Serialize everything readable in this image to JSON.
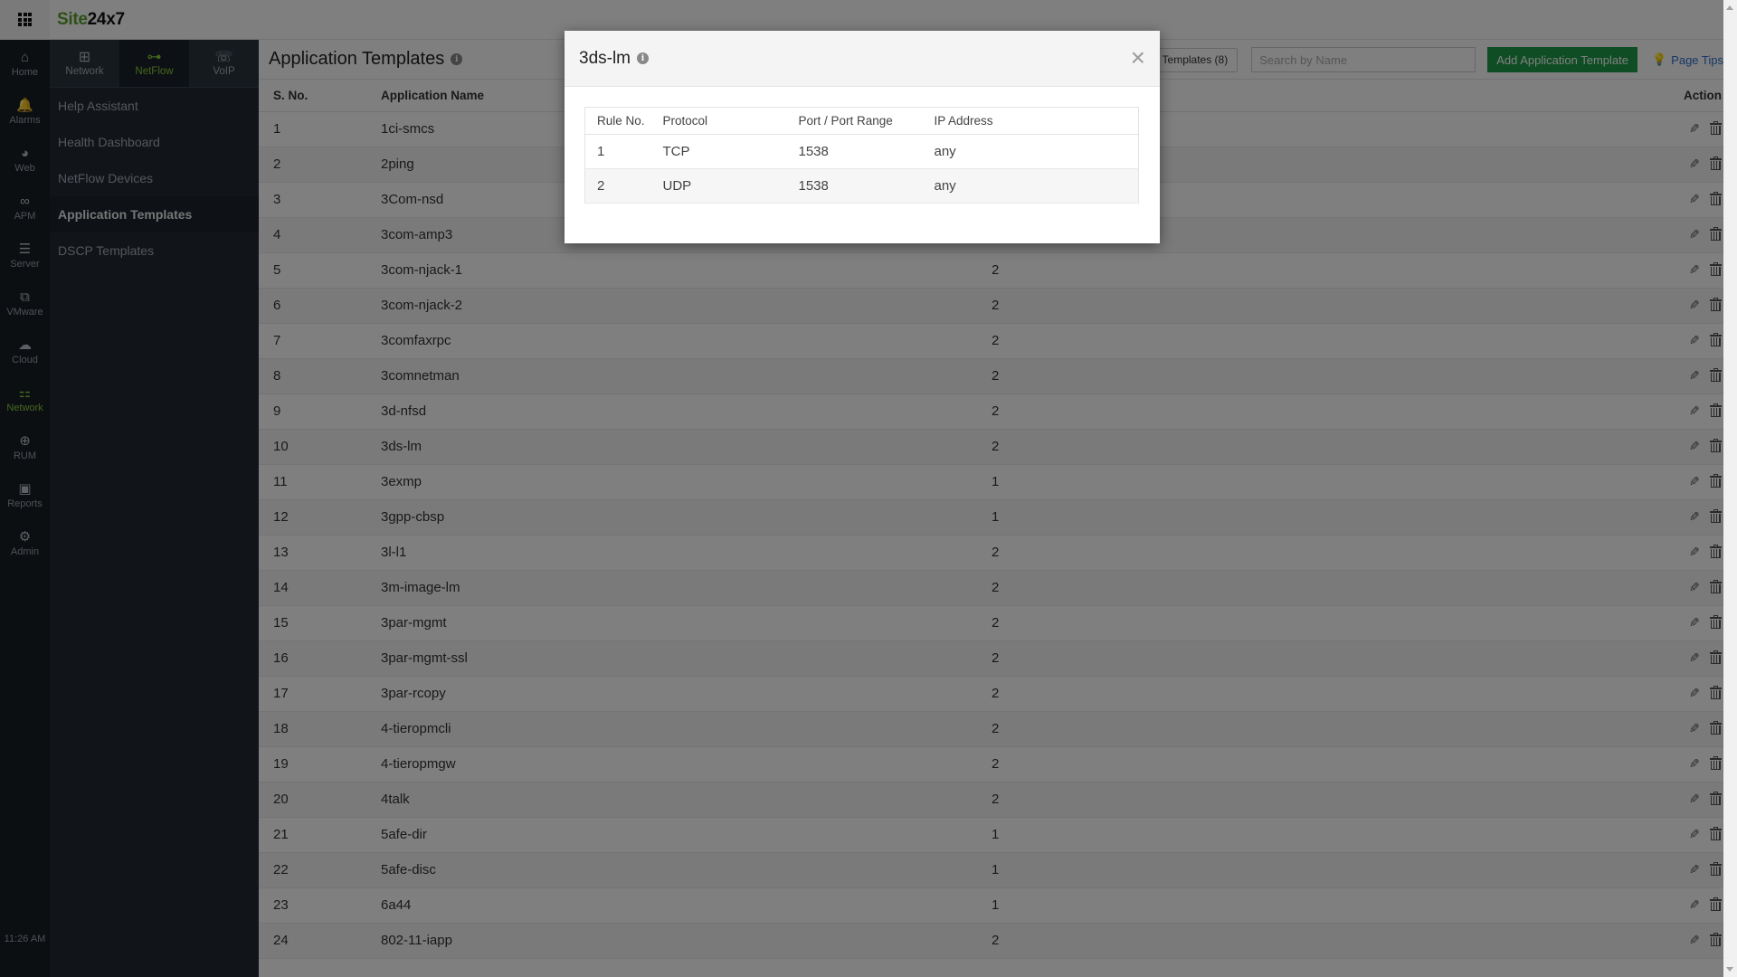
{
  "app": {
    "logo_part1": "Site",
    "logo_part2": "24x7",
    "apps_icon": "grid-icon"
  },
  "rail": {
    "items": [
      {
        "label": "Home",
        "icon": "home-icon",
        "glyph": "⌂"
      },
      {
        "label": "Alarms",
        "icon": "bell-icon",
        "glyph": "🔔"
      },
      {
        "label": "Web",
        "icon": "globe-icon",
        "glyph": "◕"
      },
      {
        "label": "APM",
        "icon": "binoculars-icon",
        "glyph": "∞"
      },
      {
        "label": "Server",
        "icon": "server-icon",
        "glyph": "☰"
      },
      {
        "label": "VMware",
        "icon": "vmware-icon",
        "glyph": "⧉"
      },
      {
        "label": "Cloud",
        "icon": "cloud-icon",
        "glyph": "☁"
      },
      {
        "label": "Network",
        "icon": "network-icon",
        "glyph": "⚏",
        "active": true
      },
      {
        "label": "RUM",
        "icon": "rum-icon",
        "glyph": "⊕"
      },
      {
        "label": "Reports",
        "icon": "reports-icon",
        "glyph": "▣"
      },
      {
        "label": "Admin",
        "icon": "gear-icon",
        "glyph": "⚙"
      }
    ],
    "time": "11:26 AM"
  },
  "sidebar": {
    "tabs": [
      {
        "label": "Network",
        "icon": "network-devices-icon",
        "glyph": "⊞"
      },
      {
        "label": "NetFlow",
        "icon": "netflow-icon",
        "glyph": "⊶",
        "active": true
      },
      {
        "label": "VoIP",
        "icon": "voip-icon",
        "glyph": "☏"
      }
    ],
    "items": [
      {
        "label": "Help Assistant"
      },
      {
        "label": "Health Dashboard"
      },
      {
        "label": "NetFlow Devices"
      },
      {
        "label": "Application Templates",
        "active": true
      },
      {
        "label": "DSCP Templates"
      }
    ]
  },
  "main": {
    "title": "Application Templates",
    "custom_templates_button": "Templates (8)",
    "search_placeholder": "Search by Name",
    "add_button": "Add Application Template",
    "page_tips": "Page Tips",
    "columns": {
      "sno": "S. No.",
      "name": "Application Name",
      "action": "Action"
    },
    "rows": [
      {
        "sno": "1",
        "name": "1ci-smcs",
        "count": ""
      },
      {
        "sno": "2",
        "name": "2ping",
        "count": ""
      },
      {
        "sno": "3",
        "name": "3Com-nsd",
        "count": ""
      },
      {
        "sno": "4",
        "name": "3com-amp3",
        "count": ""
      },
      {
        "sno": "5",
        "name": "3com-njack-1",
        "count": "2"
      },
      {
        "sno": "6",
        "name": "3com-njack-2",
        "count": "2"
      },
      {
        "sno": "7",
        "name": "3comfaxrpc",
        "count": "2"
      },
      {
        "sno": "8",
        "name": "3comnetman",
        "count": "2"
      },
      {
        "sno": "9",
        "name": "3d-nfsd",
        "count": "2"
      },
      {
        "sno": "10",
        "name": "3ds-lm",
        "count": "2"
      },
      {
        "sno": "11",
        "name": "3exmp",
        "count": "1"
      },
      {
        "sno": "12",
        "name": "3gpp-cbsp",
        "count": "1"
      },
      {
        "sno": "13",
        "name": "3l-l1",
        "count": "2"
      },
      {
        "sno": "14",
        "name": "3m-image-lm",
        "count": "2"
      },
      {
        "sno": "15",
        "name": "3par-mgmt",
        "count": "2"
      },
      {
        "sno": "16",
        "name": "3par-mgmt-ssl",
        "count": "2"
      },
      {
        "sno": "17",
        "name": "3par-rcopy",
        "count": "2"
      },
      {
        "sno": "18",
        "name": "4-tieropmcli",
        "count": "2"
      },
      {
        "sno": "19",
        "name": "4-tieropmgw",
        "count": "2"
      },
      {
        "sno": "20",
        "name": "4talk",
        "count": "2"
      },
      {
        "sno": "21",
        "name": "5afe-dir",
        "count": "1"
      },
      {
        "sno": "22",
        "name": "5afe-disc",
        "count": "1"
      },
      {
        "sno": "23",
        "name": "6a44",
        "count": "1"
      },
      {
        "sno": "24",
        "name": "802-11-iapp",
        "count": "2"
      }
    ]
  },
  "modal": {
    "title": "3ds-lm",
    "close_glyph": "×",
    "columns": {
      "rule": "Rule No.",
      "protocol": "Protocol",
      "port": "Port / Port Range",
      "ip": "IP Address"
    },
    "rules": [
      {
        "rule": "1",
        "protocol": "TCP",
        "port": "1538",
        "ip": "any"
      },
      {
        "rule": "2",
        "protocol": "UDP",
        "port": "1538",
        "ip": "any"
      }
    ]
  },
  "colors": {
    "brand_green": "#5aa02c",
    "active_green": "#8ccc3f",
    "add_button": "#1f9a49",
    "link_blue": "#2f6fd0"
  }
}
